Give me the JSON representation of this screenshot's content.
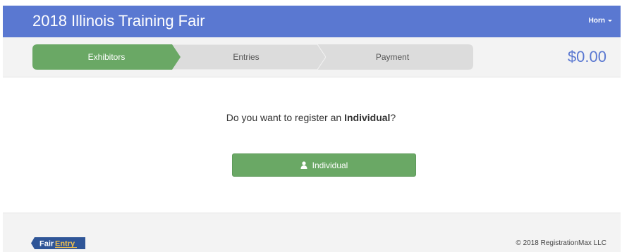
{
  "header": {
    "title": "2018 Illinois Training Fair",
    "user_label": "Horn"
  },
  "steps": [
    {
      "label": "Exhibitors",
      "active": true
    },
    {
      "label": "Entries",
      "active": false
    },
    {
      "label": "Payment",
      "active": false
    }
  ],
  "cart": {
    "total": "$0.00"
  },
  "main": {
    "prompt_prefix": "Do you want to register an ",
    "prompt_bold": "Individual",
    "prompt_suffix": "?",
    "button_label": "Individual"
  },
  "footer": {
    "logo_text_1": "Fair",
    "logo_text_2": "Entry",
    "copyright": "© 2018 RegistrationMax LLC"
  },
  "colors": {
    "brand_blue": "#5a78d1",
    "active_green": "#6aa865",
    "inactive_step": "#dcdcdc"
  }
}
